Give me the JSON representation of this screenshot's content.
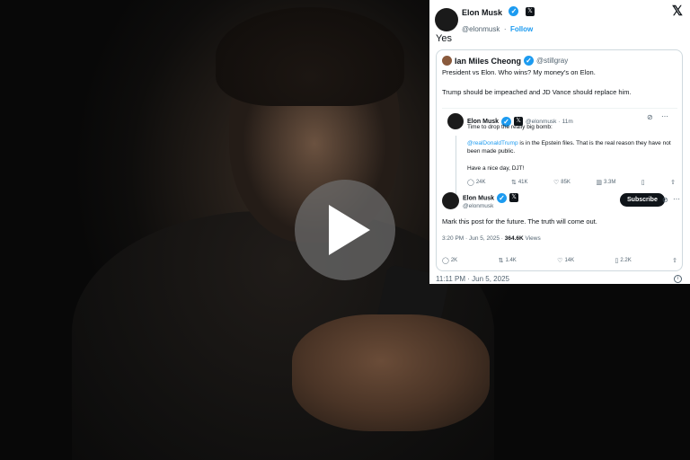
{
  "video": {
    "play_label": "Play"
  },
  "tweet": {
    "author_name": "Elon Musk",
    "author_handle": "@elonmusk",
    "separator": "·",
    "follow_label": "Follow",
    "text": "Yes",
    "timestamp": "11:11 PM · Jun 5, 2025",
    "quote": {
      "author_name": "Ian Miles Cheong",
      "author_handle": "@stillgray",
      "line1": "President vs Elon. Who wins? My money’s on Elon.",
      "line2": "Trump should be impeached and JD Vance should replace him.",
      "inner": {
        "author_name": "Elon Musk",
        "author_handle": "@elonmusk",
        "age": "11m",
        "line1": "Time to drop the really big bomb:",
        "mention": "@realDonaldTrump",
        "line2": " is in the Epstein files. That is the real reason they have not been made public.",
        "line3": "Have a nice day, DJT!",
        "stats": {
          "replies": "24K",
          "reposts": "41K",
          "likes": "85K",
          "views": "3.3M"
        }
      },
      "reply": {
        "author_name": "Elon Musk",
        "author_handle": "@elonmusk",
        "subscribe_label": "Subscribe",
        "text": "Mark this post for the future. The truth will come out.",
        "time": "3:20 PM · Jun 5, 2025 · ",
        "views_count": "364.6K",
        "views_label": " Views",
        "stats": {
          "replies": "2K",
          "reposts": "1.4K",
          "likes": "14K",
          "bookmarks": "2.2K"
        }
      }
    }
  },
  "icons": [
    "play-icon",
    "x-logo-icon",
    "verified-icon",
    "reply-icon",
    "repost-icon",
    "like-icon",
    "views-icon",
    "bookmark-icon",
    "share-icon",
    "grok-icon",
    "more-icon",
    "info-icon"
  ],
  "colors": {
    "accent": "#1d9bf0",
    "text": "#0f1419",
    "muted": "#536471",
    "border": "#cfd9de"
  }
}
